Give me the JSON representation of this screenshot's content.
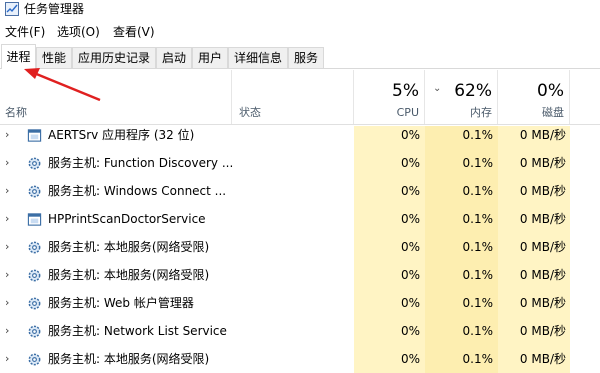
{
  "window": {
    "title": "任务管理器"
  },
  "menu": [
    "文件(F)",
    "选项(O)",
    "查看(V)"
  ],
  "tabs": [
    "进程",
    "性能",
    "应用历史记录",
    "启动",
    "用户",
    "详细信息",
    "服务"
  ],
  "header": {
    "name": "名称",
    "status": "状态",
    "cpu_pct": "5%",
    "cpu_label": "CPU",
    "mem_pct": "62%",
    "mem_label": "内存",
    "disk_pct": "0%",
    "disk_label": "磁盘"
  },
  "processes": [
    {
      "name": "AERTSrv 应用程序 (32 位)",
      "icon": "window-icon",
      "cpu": "0%",
      "mem": "0.1%",
      "disk": "0 MB/秒"
    },
    {
      "name": "服务主机: Function Discovery ...",
      "icon": "gear-icon",
      "cpu": "0%",
      "mem": "0.1%",
      "disk": "0 MB/秒"
    },
    {
      "name": "服务主机: Windows Connect ...",
      "icon": "gear-icon",
      "cpu": "0%",
      "mem": "0.1%",
      "disk": "0 MB/秒"
    },
    {
      "name": "HPPrintScanDoctorService",
      "icon": "window-icon",
      "cpu": "0%",
      "mem": "0.1%",
      "disk": "0 MB/秒"
    },
    {
      "name": "服务主机: 本地服务(网络受限)",
      "icon": "gear-icon",
      "cpu": "0%",
      "mem": "0.1%",
      "disk": "0 MB/秒"
    },
    {
      "name": "服务主机: 本地服务(网络受限)",
      "icon": "gear-icon",
      "cpu": "0%",
      "mem": "0.1%",
      "disk": "0 MB/秒"
    },
    {
      "name": "服务主机: Web 帐户管理器",
      "icon": "gear-icon",
      "cpu": "0%",
      "mem": "0.1%",
      "disk": "0 MB/秒"
    },
    {
      "name": "服务主机: Network List Service",
      "icon": "gear-icon",
      "cpu": "0%",
      "mem": "0.1%",
      "disk": "0 MB/秒"
    },
    {
      "name": "服务主机: 本地服务(网络受限)",
      "icon": "gear-icon",
      "cpu": "0%",
      "mem": "0.1%",
      "disk": "0 MB/秒"
    }
  ],
  "colors": {
    "cpu_column": "#fff4c4",
    "mem_column": "#fdeeb0",
    "disk_column": "#fff4c4",
    "annotation_arrow": "#e02020"
  }
}
